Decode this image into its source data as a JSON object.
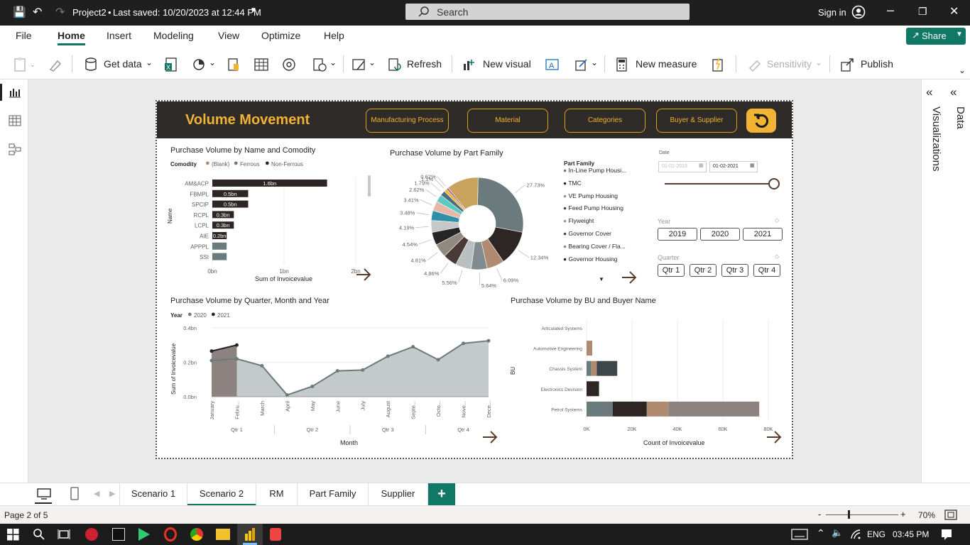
{
  "titlebar": {
    "file_name": "Project2",
    "saved_status": "Last saved: 10/20/2023 at 12:44 PM",
    "search_placeholder": "Search",
    "sign_in": "Sign in"
  },
  "menu": {
    "items": [
      "File",
      "Home",
      "Insert",
      "Modeling",
      "View",
      "Optimize",
      "Help"
    ],
    "active": "Home",
    "share_label": "Share"
  },
  "ribbon": {
    "get_data": "Get data",
    "refresh": "Refresh",
    "new_visual": "New visual",
    "new_measure": "New measure",
    "sensitivity": "Sensitivity",
    "publish": "Publish"
  },
  "panes": {
    "visualizations": "Visualizations",
    "data": "Data"
  },
  "report": {
    "title": "Volume Movement",
    "nav_buttons": [
      "Manufacturing Process",
      "Material",
      "Categories",
      "Buyer & Supplier"
    ],
    "bar_chart": {
      "title": "Purchase Volume by Name and Comodity",
      "legend_title": "Comodity",
      "legend": [
        "(Blank)",
        "Ferrous",
        "Non-Ferrous"
      ],
      "ylabel": "Name",
      "xlabel": "Sum of Invoicevalue",
      "names": [
        "AM&ACP",
        "FBMPL",
        "SPCIP",
        "RCPL",
        "LCPL",
        "AIE",
        "APPPL",
        "SSI"
      ],
      "value_labels": [
        "1.6bn",
        "0.5bn",
        "0.5bn",
        "0.3bn",
        "0.3bn",
        "0.2bn",
        "",
        ""
      ],
      "x_ticks": [
        "0bn",
        "1bn",
        "2bn"
      ]
    },
    "donut": {
      "title": "Purchase Volume by Part Family",
      "labels": [
        "27.73%",
        "12.34%",
        "6.09%",
        "5.64%",
        "5.56%",
        "4.86%",
        "4.81%",
        "4.54%",
        "4.19%",
        "3.48%",
        "3.41%",
        "2.62%",
        "1.79%",
        "1.1%",
        "0.62%"
      ],
      "legend_title": "Part Family",
      "legend": [
        "In-Line Pump Housi...",
        "TMC",
        "VE Pump Housing",
        "Feed Pump Housing",
        "Flyweight",
        "Governor Cover",
        "Bearing Cover / Fla...",
        "Governor Housing"
      ]
    },
    "slicers": {
      "date_label": "Date",
      "date_from": "01-01-2019",
      "date_to": "01-02-2021",
      "year_label": "Year",
      "years": [
        "2019",
        "2020",
        "2021"
      ],
      "quarter_label": "Quarter",
      "quarters": [
        "Qtr 1",
        "Qtr 2",
        "Qtr 3",
        "Qtr 4"
      ]
    },
    "area_chart": {
      "title": "Purchase Volume by Quarter, Month and Year",
      "legend_title": "Year",
      "legend": [
        "2020",
        "2021"
      ],
      "ylabel": "Sum of Invoicevalue",
      "xlabel": "Month",
      "y_ticks": [
        "0.4bn",
        "0.2bn",
        "0.0bn"
      ],
      "months": [
        "January",
        "Febru...",
        "March",
        "April",
        "May",
        "June",
        "July",
        "August",
        "Septe...",
        "Octo...",
        "Nove...",
        "Dece..."
      ],
      "quarters": [
        "Qtr 1",
        "Qtr 2",
        "Qtr 3",
        "Qtr 4"
      ]
    },
    "bu_chart": {
      "title": "Purchase Volume by BU and Buyer Name",
      "ylabel": "BU",
      "xlabel": "Count of Invoicevalue",
      "categories": [
        "Articulated Systems",
        "Automotive Engineering",
        "Chassis System",
        "Electronics Devision",
        "Petrol Systems"
      ],
      "x_ticks": [
        "0K",
        "20K",
        "40K",
        "60K",
        "80K"
      ]
    }
  },
  "chart_data": [
    {
      "type": "bar",
      "title": "Purchase Volume by Name and Comodity",
      "xlabel": "Sum of Invoicevalue",
      "ylabel": "Name",
      "categories": [
        "AM&ACP",
        "FBMPL",
        "SPCIP",
        "RCPL",
        "LCPL",
        "AIE",
        "APPPL",
        "SSI"
      ],
      "values": [
        1.6,
        0.5,
        0.5,
        0.3,
        0.3,
        0.2,
        0.2,
        0.2
      ],
      "xlim": [
        0,
        2
      ]
    },
    {
      "type": "pie",
      "title": "Purchase Volume by Part Family",
      "values": [
        27.73,
        12.34,
        6.09,
        5.64,
        5.56,
        4.86,
        4.81,
        4.54,
        4.19,
        3.48,
        3.41,
        2.62,
        1.79,
        1.1,
        0.62
      ],
      "colors": [
        "#6b7a7d",
        "#2e2624",
        "#b08a70",
        "#7f8b8e",
        "#b8bfc1",
        "#4a3b37",
        "#918880",
        "#262626",
        "#c4c8c9",
        "#2f8fa6",
        "#e6b7a9",
        "#5bc9c1",
        "#4c6e7a",
        "#f2b233",
        "#8a5f8a"
      ]
    },
    {
      "type": "area",
      "title": "Purchase Volume by Quarter, Month and Year",
      "xlabel": "Month",
      "ylabel": "Sum of Invoicevalue",
      "categories": [
        "January",
        "Febru...",
        "March",
        "April",
        "May",
        "June",
        "July",
        "August",
        "Septe...",
        "Octo...",
        "Nove...",
        "Dece..."
      ],
      "series": [
        {
          "name": "2020",
          "values": [
            0.21,
            0.22,
            0.18,
            0.01,
            0.06,
            0.15,
            0.155,
            0.235,
            0.29,
            0.215,
            0.31,
            0.325
          ]
        },
        {
          "name": "2021",
          "values": [
            0.265,
            0.3
          ]
        }
      ],
      "ylim": [
        0,
        0.4
      ]
    },
    {
      "type": "bar",
      "title": "Purchase Volume by BU and Buyer Name",
      "xlabel": "Count of Invoicevalue",
      "ylabel": "BU",
      "categories": [
        "Articulated Systems",
        "Automotive Engineering",
        "Chassis System",
        "Electronics Devision",
        "Petrol Systems"
      ],
      "stacked": true,
      "segments": [
        [],
        [
          {
            "value": 2500,
            "color": "#b08a70"
          }
        ],
        [
          {
            "value": 2000,
            "color": "#6b7a7d"
          },
          {
            "value": 2500,
            "color": "#b08a70"
          },
          {
            "value": 9000,
            "color": "#3d4648"
          }
        ],
        [
          {
            "value": 5500,
            "color": "#2e2624"
          }
        ],
        [
          {
            "value": 11500,
            "color": "#6b7a7d"
          },
          {
            "value": 15000,
            "color": "#2e2624"
          },
          {
            "value": 9500,
            "color": "#b08a70"
          },
          {
            "value": 40000,
            "color": "#8c8380"
          }
        ]
      ],
      "xlim": [
        0,
        80000
      ]
    }
  ],
  "page_tabs": [
    "Scenario 1",
    "Scenario 2",
    "RM",
    "Part Family",
    "Supplier"
  ],
  "active_tab": "Scenario 2",
  "status": {
    "page": "Page 2 of 5",
    "zoom": "70%"
  },
  "taskbar": {
    "lang": "ENG",
    "time": "03:45 PM"
  }
}
